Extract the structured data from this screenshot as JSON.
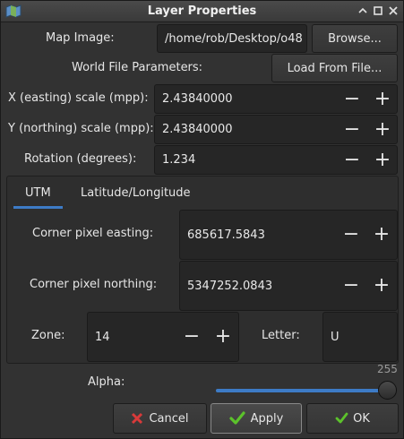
{
  "window": {
    "title": "Layer Properties",
    "icon": "map-layer-icon",
    "controls": [
      "minimize-icon",
      "maximize-icon",
      "close-icon"
    ]
  },
  "map_image": {
    "label": "Map Image:",
    "value": "/home/rob/Desktop/o48",
    "browse_label": "Browse..."
  },
  "world_file": {
    "label": "World File Parameters:",
    "load_label": "Load From File..."
  },
  "x_scale": {
    "label": "X (easting) scale (mpp):",
    "value": "2.43840000"
  },
  "y_scale": {
    "label": "Y (northing) scale (mpp):",
    "value": "2.43840000"
  },
  "rotation": {
    "label": "Rotation (degrees):",
    "value": "1.234"
  },
  "tabs": [
    {
      "label": "UTM",
      "active": true
    },
    {
      "label": "Latitude/Longitude",
      "active": false
    }
  ],
  "utm": {
    "easting": {
      "label": "Corner pixel easting:",
      "value": "685617.5843"
    },
    "northing": {
      "label": "Corner pixel northing:",
      "value": "5347252.0843"
    },
    "zone": {
      "label": "Zone:",
      "value": "14"
    },
    "letter": {
      "label": "Letter:",
      "value": "U"
    }
  },
  "alpha": {
    "label": "Alpha:",
    "value": "255",
    "level": 255,
    "max": 255
  },
  "buttons": {
    "cancel": "Cancel",
    "apply": "Apply",
    "ok": "OK"
  },
  "spin": {
    "minus": "−",
    "plus": "+"
  },
  "colors": {
    "accent": "#3d7bc6",
    "cancel_icon": "#d83a3a",
    "ok_icon": "#5cc22b"
  }
}
